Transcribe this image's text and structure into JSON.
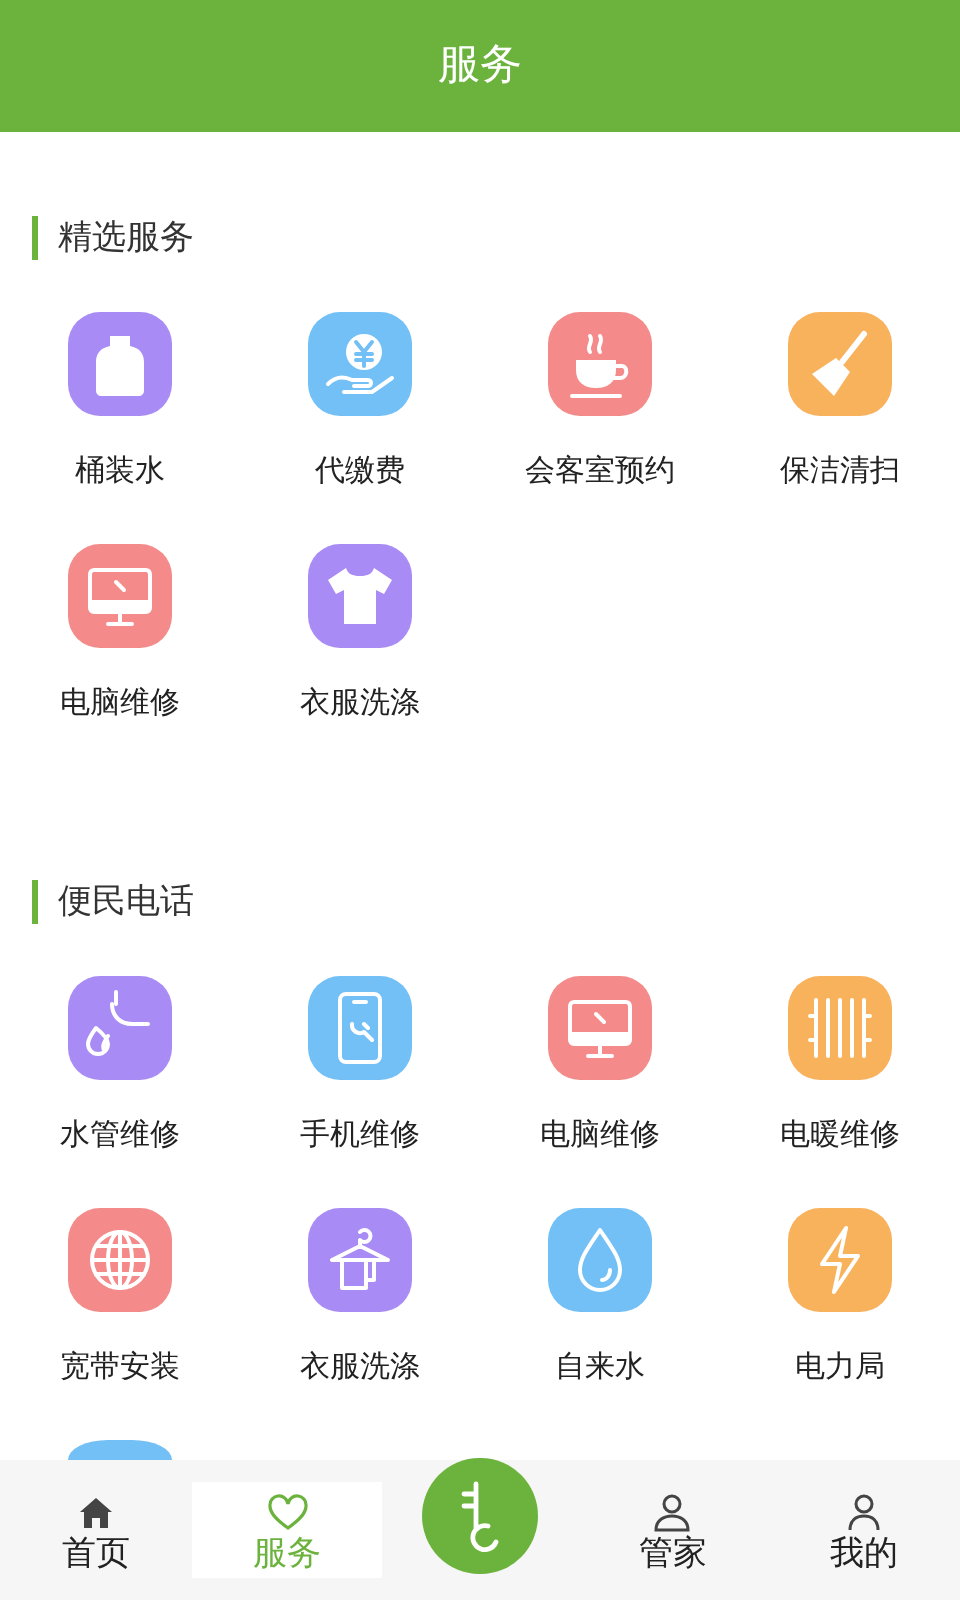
{
  "header": {
    "title": "服务"
  },
  "sections": [
    {
      "title": "精选服务",
      "items": [
        {
          "label": "桶装水",
          "color": "#a98bf5"
        },
        {
          "label": "代缴费",
          "color": "#72c0f5"
        },
        {
          "label": "会客室预约",
          "color": "#f58a8a"
        },
        {
          "label": "保洁清扫",
          "color": "#f8b25c"
        },
        {
          "label": "电脑维修",
          "color": "#f58a8a"
        },
        {
          "label": "衣服洗涤",
          "color": "#a98bf5"
        }
      ]
    },
    {
      "title": "便民电话",
      "items": [
        {
          "label": "水管维修",
          "color": "#a98bf5"
        },
        {
          "label": "手机维修",
          "color": "#72c0f5"
        },
        {
          "label": "电脑维修",
          "color": "#f58a8a"
        },
        {
          "label": "电暖维修",
          "color": "#f8b25c"
        },
        {
          "label": "宽带安装",
          "color": "#f58a8a"
        },
        {
          "label": "衣服洗涤",
          "color": "#a98bf5"
        },
        {
          "label": "自来水",
          "color": "#72c0f5"
        },
        {
          "label": "电力局",
          "color": "#f8b25c"
        },
        {
          "color": "#72c0f5"
        }
      ]
    }
  ],
  "tabbar": [
    {
      "kind": "tab",
      "label": "首页",
      "selected": false
    },
    {
      "kind": "tab",
      "label": "服务",
      "selected": true
    },
    {
      "kind": "center"
    },
    {
      "kind": "tab",
      "label": "管家",
      "selected": false
    },
    {
      "kind": "tab",
      "label": "我的",
      "selected": false
    }
  ]
}
